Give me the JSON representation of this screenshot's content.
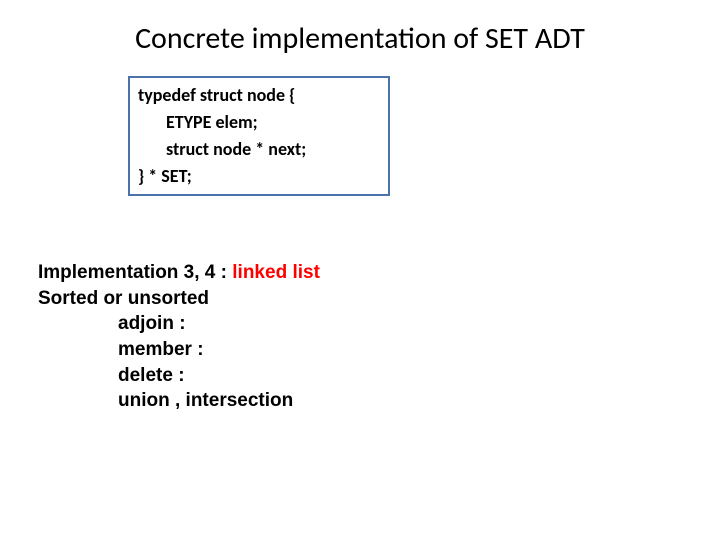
{
  "title": "Concrete implementation of SET ADT",
  "code": {
    "l1": "typedef struct node {",
    "l2": "ETYPE elem;",
    "l3": "struct node * next;",
    "l4": "} * SET;"
  },
  "body": {
    "impl_prefix": "Implementation 3, 4 : ",
    "impl_red": "linked list",
    "sorted": "Sorted or unsorted",
    "adjoin": "adjoin :",
    "member": "member :",
    "delete": "delete :",
    "union": "union , intersection"
  }
}
